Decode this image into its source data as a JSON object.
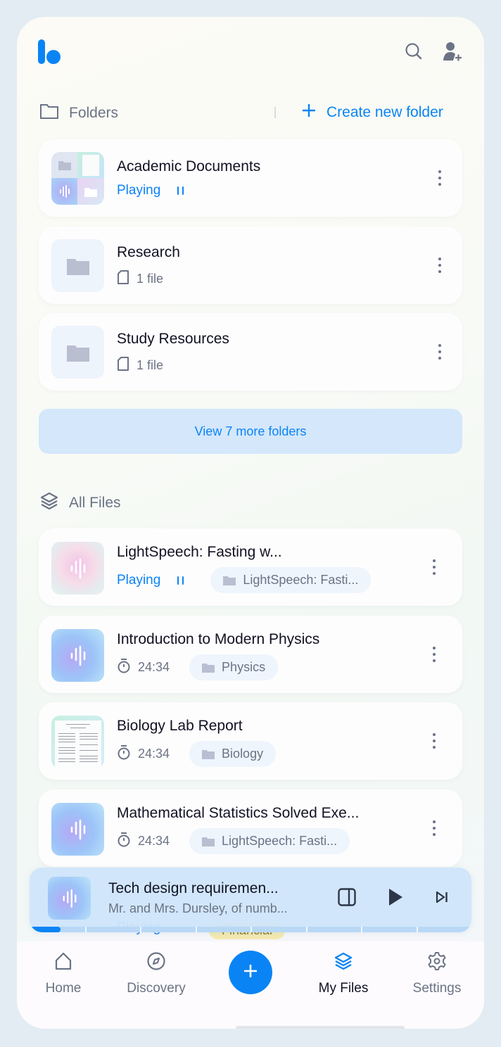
{
  "header": {
    "logo": "app-logo",
    "icons": [
      "search-icon",
      "add-user-icon"
    ]
  },
  "folders_section": {
    "title": "Folders",
    "create_label": "Create new folder",
    "folders": [
      {
        "name": "Academic Documents",
        "status": "Playing",
        "thumb": "collage"
      },
      {
        "name": "Research",
        "count": "1 file",
        "thumb": "folder"
      },
      {
        "name": "Study Resources",
        "count": "1 file",
        "thumb": "folder"
      }
    ],
    "view_more_label": "View 7 more folders"
  },
  "files_section": {
    "title": "All Files",
    "files": [
      {
        "title": "LightSpeech: Fasting w...",
        "status": "Playing",
        "folder": "LightSpeech: Fasti...",
        "thumb": "audio-pink"
      },
      {
        "title": "Introduction to Modern Physics",
        "duration": "24:34",
        "folder": "Physics",
        "thumb": "audio"
      },
      {
        "title": "Biology Lab Report",
        "duration": "24:34",
        "folder": "Biology",
        "thumb": "document"
      },
      {
        "title": "Mathematical Statistics Solved Exe...",
        "duration": "24:34",
        "folder": "LightSpeech: Fasti...",
        "thumb": "audio"
      }
    ],
    "peek": {
      "status": "Playing",
      "folder": "Financial"
    }
  },
  "player": {
    "title": "Tech design requiremen...",
    "subtitle": "Mr. and Mrs. Dursley, of numb...",
    "progress_fraction": 0.07,
    "segments": 8
  },
  "nav": {
    "items": [
      {
        "label": "Home",
        "icon": "home-icon",
        "active": false
      },
      {
        "label": "Discovery",
        "icon": "compass-icon",
        "active": false
      },
      {
        "label": "My Files",
        "icon": "layers-icon",
        "active": true
      },
      {
        "label": "Settings",
        "icon": "gear-icon",
        "active": false
      }
    ],
    "fab": "plus-icon"
  },
  "colors": {
    "accent": "#0a84f5",
    "text_primary": "#111223",
    "text_secondary": "#6b7385",
    "view_more_bg": "#d4e7fb",
    "chip_bg": "#eef5fd"
  }
}
